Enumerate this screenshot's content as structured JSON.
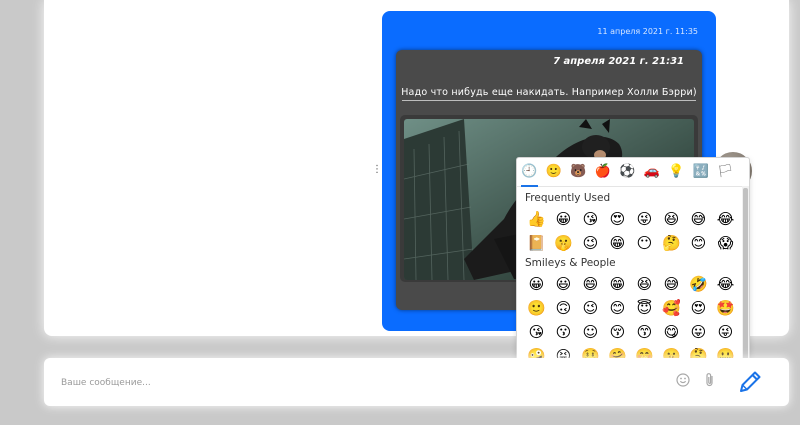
{
  "message": {
    "time": "11 апреля 2021 г. 11:35",
    "forwarded": {
      "date": "7 апреля 2021 г. 21:31",
      "text": "Надо что нибудь еще накидать. Например Холли Бэрри)"
    },
    "more_icon": "more-vertical-icon"
  },
  "emoji_picker": {
    "tabs": [
      "🕘",
      "🙂",
      "🐻",
      "🍎",
      "⚽",
      "🚗",
      "💡",
      "🔣",
      "🏳"
    ],
    "active_tab": 0,
    "sections": [
      {
        "title": "Frequently Used",
        "emojis": [
          "👍",
          "😀",
          "😘",
          "😍",
          "😜",
          "😆",
          "😅",
          "😂",
          "📔",
          "🤫",
          "😉",
          "😁",
          "😶",
          "🤔",
          "😊",
          "😱"
        ]
      },
      {
        "title": "Smileys & People",
        "emojis": [
          "😀",
          "😃",
          "😄",
          "😁",
          "😆",
          "😅",
          "🤣",
          "😂",
          "🙂",
          "🙃",
          "😉",
          "😊",
          "😇",
          "🥰",
          "😍",
          "🤩",
          "😘",
          "😗",
          "☺",
          "😚",
          "😙",
          "😋",
          "😛",
          "😜",
          "🤪",
          "😝",
          "🤑",
          "🤗",
          "🤭",
          "🤫",
          "🤔",
          "🤐"
        ]
      }
    ]
  },
  "composer": {
    "placeholder": "Ваше сообщение...",
    "emoji_icon": "smile-icon",
    "attach_icon": "paperclip-icon",
    "send_icon": "pencil-icon"
  },
  "colors": {
    "bubble": "#0a6cff",
    "accent": "#1a73e8"
  }
}
